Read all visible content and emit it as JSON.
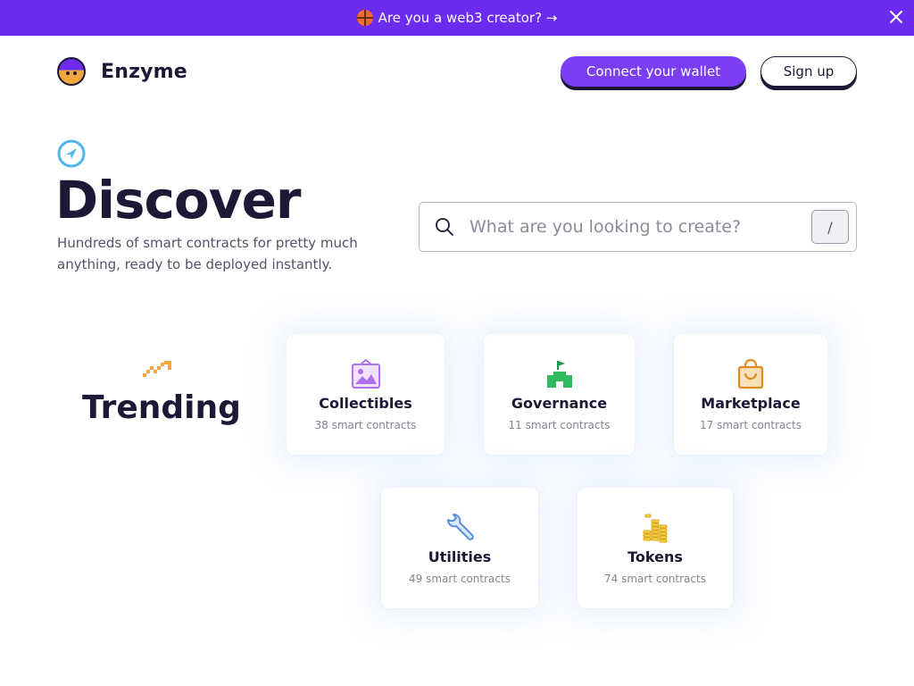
{
  "banner": {
    "text": "Are you a web3 creator? →",
    "accent": "#6b2cf0"
  },
  "brand": {
    "name": "Enzyme"
  },
  "header": {
    "connect_label": "Connect your wallet",
    "signup_label": "Sign up"
  },
  "hero": {
    "title": "Discover",
    "subtitle_line1": "Hundreds of smart contracts for pretty much",
    "subtitle_line2": "anything, ready to be deployed instantly."
  },
  "search": {
    "placeholder": "What are you looking to create?",
    "value": "",
    "shortcut": "/"
  },
  "trending": {
    "title": "Trending",
    "cards": [
      {
        "title": "Collectibles",
        "count": "38 smart contracts",
        "icon": "picture-frame-icon"
      },
      {
        "title": "Governance",
        "count": "11 smart contracts",
        "icon": "castle-flag-icon"
      },
      {
        "title": "Marketplace",
        "count": "17 smart contracts",
        "icon": "shopping-bag-icon"
      },
      {
        "title": "Utilities",
        "count": "49 smart contracts",
        "icon": "wrench-icon"
      },
      {
        "title": "Tokens",
        "count": "74 smart contracts",
        "icon": "coin-stacks-icon"
      }
    ]
  },
  "colors": {
    "primary": "#7b3ef5",
    "text_dark": "#1c1836",
    "card_shadow": "#aacdfa"
  }
}
